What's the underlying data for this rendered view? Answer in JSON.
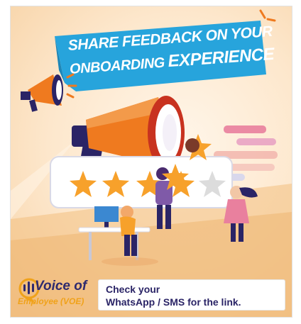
{
  "banner": {
    "line1": "Share feedback on your",
    "line2_a": "Onboarding ",
    "line2_b": "Experience"
  },
  "footer": {
    "logo_title": "Voice of",
    "logo_subtitle": "Employee (VOE)",
    "cta_line1": "Check your",
    "cta_line2": "WhatsApp / SMS for the link."
  },
  "rating": {
    "filled_stars": 4,
    "total_stars": 5
  },
  "colors": {
    "banner_blue": "#27a4dc",
    "megaphone_orange": "#ef7a1f",
    "star_orange": "#f7a12b",
    "navy": "#2a2466",
    "logo_gold": "#f0a21a"
  }
}
